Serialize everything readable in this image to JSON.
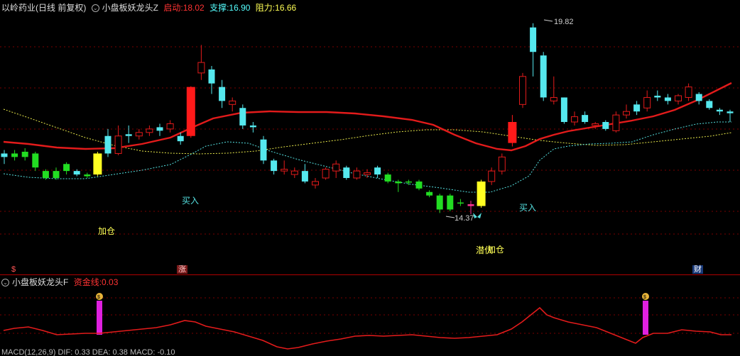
{
  "main_header": {
    "title": "以岭药业(日线 前复权)",
    "indicator_name": "小盘板妖龙头Z",
    "start_label": "启动:",
    "start_value": "18.02",
    "support_label": "支撑:",
    "support_value": "16.90",
    "resist_label": "阻力:",
    "resist_value": "16.66",
    "colors": {
      "start": "#ff3333",
      "support": "#55ffff",
      "resist": "#ffff55"
    }
  },
  "sub_header": {
    "indicator_name": "小盘板妖龙头F",
    "fund_label": "资金线:",
    "fund_value": "0.03"
  },
  "bottom_header": {
    "text": "MACD(12,26,9) DIF: 0.33 DEA: 0.38 MACD: -0.10"
  },
  "annotations": {
    "high_label": "19.82",
    "low_label": "14.37",
    "buy1": "买入",
    "buy2": "买入",
    "add": "加仓",
    "hidden": "潜伏",
    "hidden_add": "加仓"
  },
  "markers": {
    "s_marker": "$",
    "zhang": "涨",
    "cai": "财"
  },
  "chart_data": {
    "type": "candlestick",
    "candles": [
      {
        "o": 16.0,
        "c": 16.1,
        "h": 16.2,
        "l": 15.8,
        "col": "cyan"
      },
      {
        "o": 16.0,
        "c": 16.1,
        "h": 16.2,
        "l": 15.9,
        "col": "green"
      },
      {
        "o": 16.0,
        "c": 16.15,
        "h": 16.25,
        "l": 15.9,
        "col": "green"
      },
      {
        "o": 16.1,
        "c": 15.7,
        "h": 16.15,
        "l": 15.6,
        "col": "green"
      },
      {
        "o": 15.6,
        "c": 15.4,
        "h": 15.65,
        "l": 15.35,
        "col": "green"
      },
      {
        "o": 15.4,
        "c": 15.6,
        "h": 15.7,
        "l": 15.35,
        "col": "green"
      },
      {
        "o": 15.6,
        "c": 15.8,
        "h": 15.85,
        "l": 15.5,
        "col": "green"
      },
      {
        "o": 15.6,
        "c": 15.5,
        "h": 15.65,
        "l": 15.45,
        "col": "cyan"
      },
      {
        "o": 15.5,
        "c": 15.45,
        "h": 15.55,
        "l": 15.4,
        "col": "green"
      },
      {
        "o": 15.5,
        "c": 16.1,
        "h": 16.15,
        "l": 15.45,
        "col": "yellow"
      },
      {
        "o": 16.1,
        "c": 16.6,
        "h": 16.8,
        "l": 16.0,
        "col": "cyan"
      },
      {
        "o": 16.1,
        "c": 16.6,
        "h": 16.9,
        "l": 16.05,
        "col": "red"
      },
      {
        "o": 16.6,
        "c": 16.65,
        "h": 16.9,
        "l": 16.4,
        "col": "cyan"
      },
      {
        "o": 16.6,
        "c": 16.7,
        "h": 16.8,
        "l": 16.5,
        "col": "red"
      },
      {
        "o": 16.7,
        "c": 16.8,
        "h": 16.9,
        "l": 16.6,
        "col": "red"
      },
      {
        "o": 16.75,
        "c": 16.85,
        "h": 16.95,
        "l": 16.6,
        "col": "cyan"
      },
      {
        "o": 16.8,
        "c": 16.95,
        "h": 17.05,
        "l": 16.7,
        "col": "red"
      },
      {
        "o": 16.6,
        "c": 16.45,
        "h": 16.7,
        "l": 16.35,
        "col": "cyan"
      },
      {
        "o": 16.6,
        "c": 18.0,
        "h": 18.02,
        "l": 16.55,
        "col": "redfill"
      },
      {
        "o": 18.4,
        "c": 18.7,
        "h": 19.2,
        "l": 18.2,
        "col": "red"
      },
      {
        "o": 18.5,
        "c": 18.1,
        "h": 18.6,
        "l": 17.8,
        "col": "cyan"
      },
      {
        "o": 18.0,
        "c": 17.6,
        "h": 18.2,
        "l": 17.4,
        "col": "cyan"
      },
      {
        "o": 17.5,
        "c": 17.6,
        "h": 17.7,
        "l": 17.3,
        "col": "red"
      },
      {
        "o": 17.4,
        "c": 16.9,
        "h": 17.5,
        "l": 16.8,
        "col": "cyan"
      },
      {
        "o": 16.9,
        "c": 16.85,
        "h": 17.0,
        "l": 16.7,
        "col": "cyan"
      },
      {
        "o": 16.5,
        "c": 15.9,
        "h": 16.6,
        "l": 15.8,
        "col": "cyan"
      },
      {
        "o": 15.9,
        "c": 15.6,
        "h": 15.95,
        "l": 15.5,
        "col": "cyan"
      },
      {
        "o": 15.6,
        "c": 15.65,
        "h": 15.9,
        "l": 15.5,
        "col": "red"
      },
      {
        "o": 15.5,
        "c": 15.6,
        "h": 15.7,
        "l": 15.4,
        "col": "red"
      },
      {
        "o": 15.6,
        "c": 15.3,
        "h": 15.8,
        "l": 15.25,
        "col": "cyan"
      },
      {
        "o": 15.3,
        "c": 15.2,
        "h": 15.4,
        "l": 15.1,
        "col": "red"
      },
      {
        "o": 15.4,
        "c": 15.65,
        "h": 15.7,
        "l": 15.35,
        "col": "red"
      },
      {
        "o": 15.6,
        "c": 15.8,
        "h": 15.9,
        "l": 15.4,
        "col": "red"
      },
      {
        "o": 15.7,
        "c": 15.4,
        "h": 15.75,
        "l": 15.35,
        "col": "cyan"
      },
      {
        "o": 15.4,
        "c": 15.6,
        "h": 15.7,
        "l": 15.35,
        "col": "red"
      },
      {
        "o": 15.5,
        "c": 15.55,
        "h": 15.65,
        "l": 15.4,
        "col": "red"
      },
      {
        "o": 15.7,
        "c": 15.5,
        "h": 15.75,
        "l": 15.4,
        "col": "cyan"
      },
      {
        "o": 15.5,
        "c": 15.3,
        "h": 15.55,
        "l": 15.25,
        "col": "green"
      },
      {
        "o": 15.3,
        "c": 15.25,
        "h": 15.35,
        "l": 15.0,
        "col": "green"
      },
      {
        "o": 15.3,
        "c": 15.3,
        "h": 15.35,
        "l": 15.2,
        "col": "green"
      },
      {
        "o": 15.3,
        "c": 15.1,
        "h": 15.35,
        "l": 15.05,
        "col": "green"
      },
      {
        "o": 15.0,
        "c": 14.9,
        "h": 15.05,
        "l": 14.85,
        "col": "green"
      },
      {
        "o": 14.9,
        "c": 14.5,
        "h": 14.95,
        "l": 14.4,
        "col": "green"
      },
      {
        "o": 14.9,
        "c": 14.5,
        "h": 14.95,
        "l": 14.45,
        "col": "green"
      },
      {
        "o": 14.7,
        "c": 14.7,
        "h": 14.8,
        "l": 14.6,
        "col": "green"
      },
      {
        "o": 14.6,
        "c": 14.65,
        "h": 14.75,
        "l": 14.37,
        "col": "magenta"
      },
      {
        "o": 14.6,
        "c": 15.3,
        "h": 15.35,
        "l": 14.55,
        "col": "yellow"
      },
      {
        "o": 15.3,
        "c": 15.6,
        "h": 15.7,
        "l": 15.2,
        "col": "red"
      },
      {
        "o": 15.6,
        "c": 16.0,
        "h": 16.1,
        "l": 15.5,
        "col": "red"
      },
      {
        "o": 16.4,
        "c": 17.0,
        "h": 17.2,
        "l": 16.3,
        "col": "redfill"
      },
      {
        "o": 17.5,
        "c": 18.3,
        "h": 18.4,
        "l": 17.4,
        "col": "red"
      },
      {
        "o": 19.7,
        "c": 19.0,
        "h": 19.82,
        "l": 18.3,
        "col": "cyan"
      },
      {
        "o": 18.9,
        "c": 17.7,
        "h": 19.0,
        "l": 17.6,
        "col": "cyan"
      },
      {
        "o": 17.6,
        "c": 17.7,
        "h": 18.3,
        "l": 17.5,
        "col": "red"
      },
      {
        "o": 17.7,
        "c": 17.0,
        "h": 17.7,
        "l": 16.95,
        "col": "cyan"
      },
      {
        "o": 17.0,
        "c": 17.15,
        "h": 17.3,
        "l": 16.9,
        "col": "red"
      },
      {
        "o": 17.0,
        "c": 17.2,
        "h": 17.3,
        "l": 16.95,
        "col": "cyan"
      },
      {
        "o": 16.9,
        "c": 16.95,
        "h": 17.0,
        "l": 16.8,
        "col": "red"
      },
      {
        "o": 17.0,
        "c": 16.8,
        "h": 17.05,
        "l": 16.75,
        "col": "cyan"
      },
      {
        "o": 16.75,
        "c": 17.2,
        "h": 17.3,
        "l": 16.7,
        "col": "red"
      },
      {
        "o": 17.2,
        "c": 17.3,
        "h": 17.5,
        "l": 17.1,
        "col": "red"
      },
      {
        "o": 17.3,
        "c": 17.5,
        "h": 17.6,
        "l": 17.2,
        "col": "cyan"
      },
      {
        "o": 17.4,
        "c": 17.7,
        "h": 17.9,
        "l": 17.3,
        "col": "red"
      },
      {
        "o": 17.7,
        "c": 17.75,
        "h": 17.9,
        "l": 17.6,
        "col": "cyan"
      },
      {
        "o": 17.7,
        "c": 17.6,
        "h": 17.8,
        "l": 17.5,
        "col": "cyan"
      },
      {
        "o": 17.6,
        "c": 17.75,
        "h": 17.8,
        "l": 17.5,
        "col": "red"
      },
      {
        "o": 17.7,
        "c": 18.0,
        "h": 18.1,
        "l": 17.6,
        "col": "red"
      },
      {
        "o": 17.8,
        "c": 17.6,
        "h": 17.85,
        "l": 17.5,
        "col": "cyan"
      },
      {
        "o": 17.6,
        "c": 17.4,
        "h": 17.65,
        "l": 17.35,
        "col": "cyan"
      },
      {
        "o": 17.35,
        "c": 17.3,
        "h": 17.4,
        "l": 17.2,
        "col": "cyan"
      },
      {
        "o": 17.3,
        "c": 17.25,
        "h": 17.35,
        "l": 17.0,
        "col": "cyan"
      }
    ],
    "ylim": [
      13.8,
      20.2
    ]
  }
}
